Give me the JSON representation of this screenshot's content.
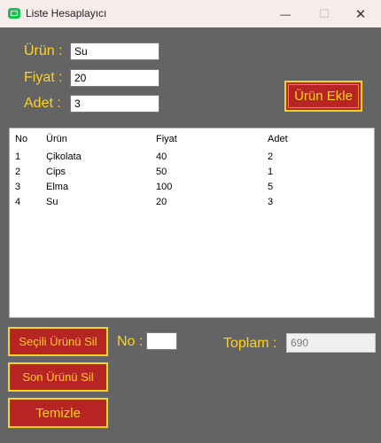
{
  "window": {
    "title": "Liste Hesaplayıcı",
    "min_glyph": "—",
    "max_glyph": "☐",
    "close_glyph": "✕"
  },
  "labels": {
    "urun": "Ürün :",
    "fiyat": "Fiyat :",
    "adet": "Adet :",
    "no": "No :",
    "toplam": "Toplam :"
  },
  "inputs": {
    "urun": "Su",
    "fiyat": "20",
    "adet": "3",
    "no": "",
    "toplam": "690"
  },
  "buttons": {
    "urun_ekle": "Ürün Ekle",
    "secili_sil": "Seçili Ürünü Sil",
    "son_sil": "Son Ürünü Sil",
    "temizle": "Temizle"
  },
  "list": {
    "columns": [
      "No",
      "Ürün",
      "Fiyat",
      "Adet"
    ],
    "rows": [
      [
        "1",
        "Çikolata",
        "40",
        "2"
      ],
      [
        "2",
        "Cips",
        "50",
        "1"
      ],
      [
        "3",
        "Elma",
        "100",
        "5"
      ],
      [
        "4",
        "Su",
        "20",
        "3"
      ]
    ]
  },
  "colors": {
    "background": "#646464",
    "accent_text": "#ffd21a",
    "button_fill": "#b72424",
    "titlebar": "#f7ecec",
    "app_icon": "#18c54f"
  }
}
